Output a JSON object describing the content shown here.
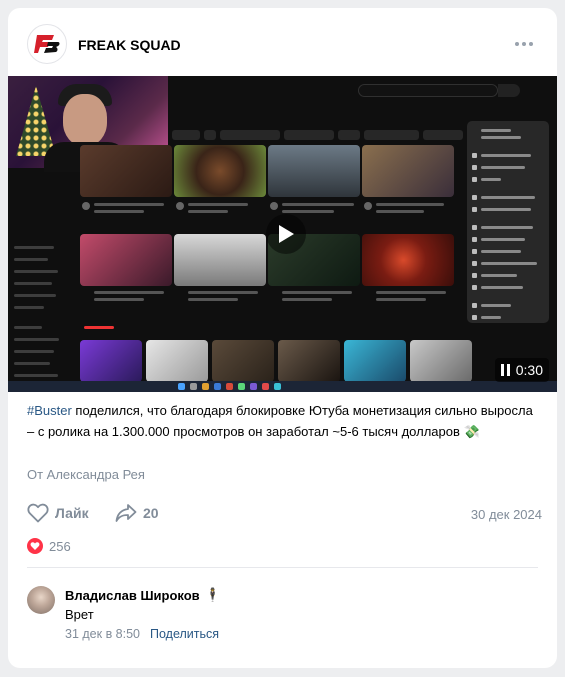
{
  "group": {
    "name": "FREAK SQUAD",
    "logo_icon": "freak-squad-logo",
    "more_icon": "more-dots-icon"
  },
  "video": {
    "duration": "0:30",
    "play_icon": "play-icon"
  },
  "post": {
    "hashtag": "#Buster",
    "text": " поделился, что благодаря блокировке Ютуба монетизация сильно выросла – с ролика на 1.300.000 просмотров он заработал ~5-6 тысяч долларов",
    "emoji": "💸",
    "source": "От Александра Рея",
    "date": "30 дек 2024"
  },
  "actions": {
    "like_label": "Лайк",
    "share_count": "20"
  },
  "reactions": {
    "count": "256"
  },
  "comment": {
    "author": "Владислав Широков",
    "author_emoji": "🕴",
    "text": "Врет",
    "time": "31 дек в 8:50",
    "share_label": "Поделиться"
  },
  "colors": {
    "link": "#2a5885",
    "secondary": "#818c99",
    "like_red": "#ff3347",
    "brand": "#d6202b"
  }
}
